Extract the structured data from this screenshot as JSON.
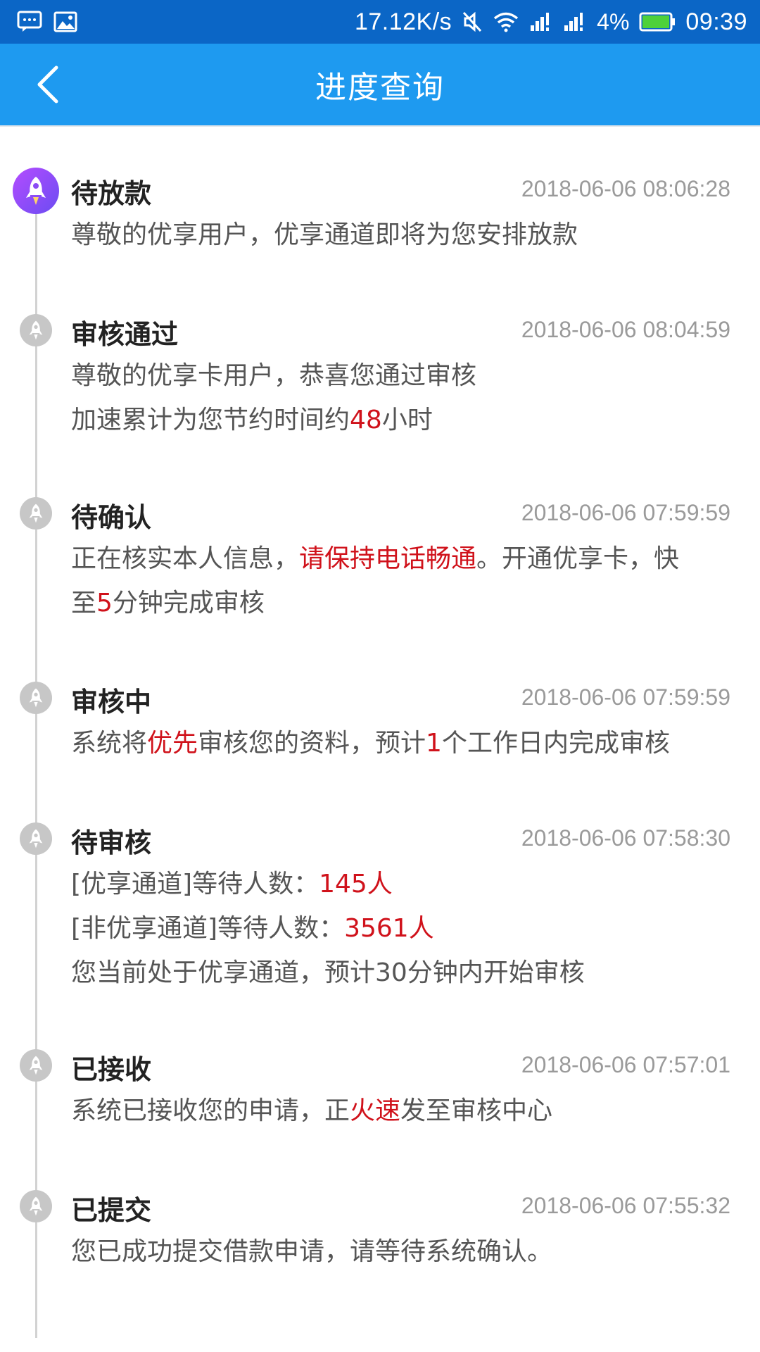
{
  "status_bar": {
    "network_speed": "17.12K/s",
    "battery_percent": "4%",
    "time": "09:39"
  },
  "nav": {
    "title": "进度查询"
  },
  "entries": [
    {
      "title": "待放款",
      "time": "2018-06-06 08:06:28",
      "lines": [
        [
          "尊敬的优享用户，优享通道即将为您安排放款"
        ]
      ]
    },
    {
      "title": "审核通过",
      "time": "2018-06-06 08:04:59",
      "lines": [
        [
          "尊敬的优享卡用户，恭喜您通过审核"
        ],
        [
          "加速累计为您节约时间约",
          "48",
          "小时"
        ]
      ]
    },
    {
      "title": "待确认",
      "time": "2018-06-06 07:59:59",
      "lines": [
        [
          "正在核实本人信息，",
          "请保持电话畅通",
          "。开通优享卡，快"
        ],
        [
          "至",
          "5",
          "分钟完成审核"
        ]
      ]
    },
    {
      "title": "审核中",
      "time": "2018-06-06 07:59:59",
      "lines": [
        [
          "系统将",
          "优先",
          "审核您的资料，预计",
          "1",
          "个工作日内完成审核"
        ]
      ]
    },
    {
      "title": "待审核",
      "time": "2018-06-06 07:58:30",
      "lines": [
        [
          "[优享通道]等待人数：",
          "145人"
        ],
        [
          "[非优享通道]等待人数：",
          "3561人"
        ],
        [
          "您当前处于优享通道，预计30分钟内开始审核"
        ]
      ]
    },
    {
      "title": "已接收",
      "time": "2018-06-06 07:57:01",
      "lines": [
        [
          "系统已接收您的申请，正",
          "火速",
          "发至审核中心"
        ]
      ]
    },
    {
      "title": "已提交",
      "time": "2018-06-06 07:55:32",
      "lines": [
        [
          "您已成功提交借款申请，请等待系统确认。"
        ]
      ]
    }
  ]
}
